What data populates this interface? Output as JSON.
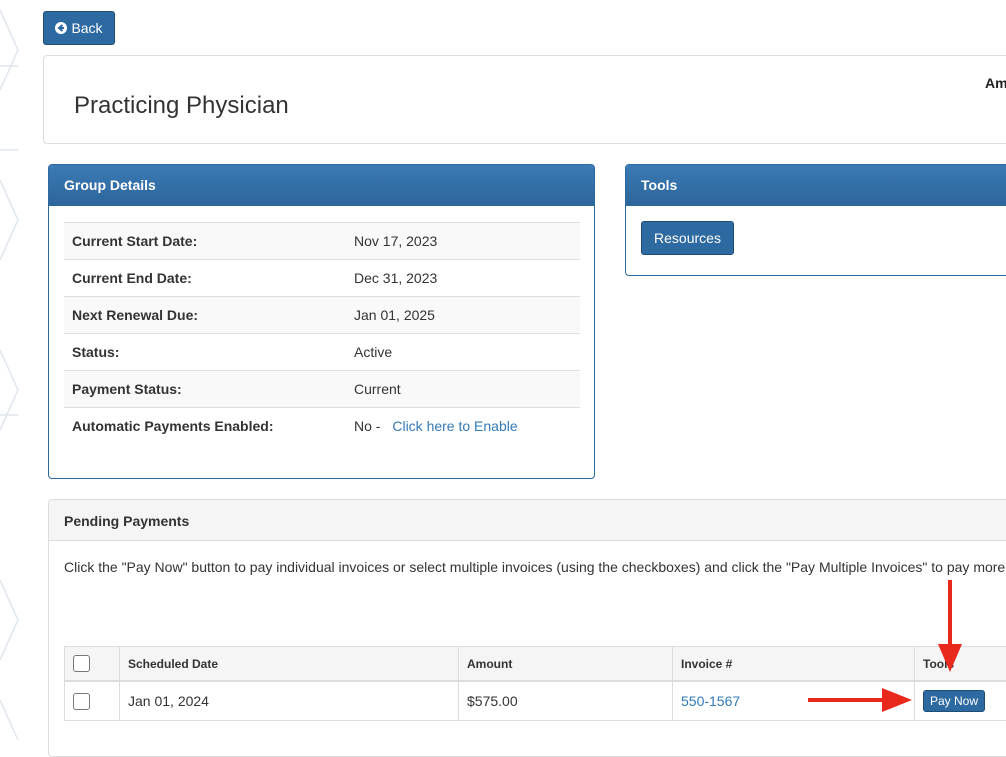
{
  "toolbar": {
    "back_label": "Back"
  },
  "header": {
    "title": "Practicing Physician",
    "right_text": "Am"
  },
  "group_details": {
    "heading": "Group Details",
    "rows": [
      {
        "label": "Current Start Date:",
        "value": "Nov 17, 2023"
      },
      {
        "label": "Current End Date:",
        "value": "Dec 31, 2023"
      },
      {
        "label": "Next Renewal Due:",
        "value": "Jan 01, 2025"
      },
      {
        "label": "Status:",
        "value": "Active"
      },
      {
        "label": "Payment Status:",
        "value": "Current"
      },
      {
        "label": "Automatic Payments Enabled:",
        "value": "No -",
        "link": "Click here to Enable"
      }
    ]
  },
  "tools": {
    "heading": "Tools",
    "resources_label": "Resources"
  },
  "pending": {
    "heading": "Pending Payments",
    "description": "Click the \"Pay Now\" button to pay individual invoices or select multiple invoices (using the checkboxes) and click the \"Pay Multiple Invoices\" to pay more time.",
    "columns": {
      "date": "Scheduled Date",
      "amount": "Amount",
      "invoice": "Invoice #",
      "tools": "Tools"
    },
    "rows": [
      {
        "date": "Jan 01, 2024",
        "amount": "$575.00",
        "invoice": "550-1567",
        "action": "Pay Now"
      }
    ]
  },
  "colors": {
    "primary": "#2d6aa1",
    "link": "#337ab7",
    "annotation_arrow": "#e8291c"
  }
}
